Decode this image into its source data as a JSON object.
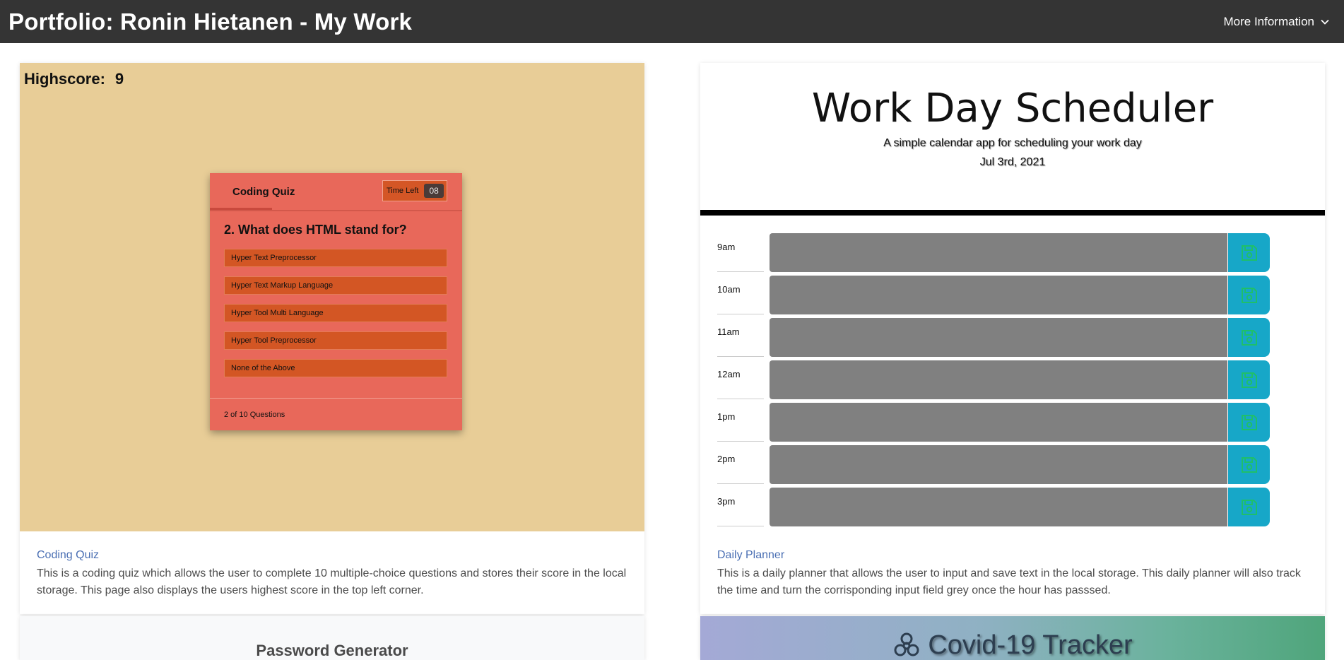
{
  "navbar": {
    "brand": "Portfolio: Ronin Hietanen - My Work",
    "more_label": "More Information"
  },
  "quiz_card": {
    "highscore_label": "Highscore:",
    "highscore_value": "9",
    "quiz_title": "Coding Quiz",
    "timer_label": "Time Left",
    "timer_value": "08",
    "question": "2. What does HTML stand for?",
    "answers": [
      "Hyper Text Preprocessor",
      "Hyper Text Markup Language",
      "Hyper Tool Multi Language",
      "Hyper Tool Preprocessor",
      "None of the Above"
    ],
    "progress": "2 of 10 Questions",
    "link": "Coding Quiz",
    "description": "This is a coding quiz which allows the user to complete 10 multiple-choice questions and stores their score in the local storage. This page also displays the users highest score in the top left corner."
  },
  "planner_card": {
    "title": "Work Day Scheduler",
    "subtitle": "A simple calendar app for scheduling your work day",
    "date": "Jul 3rd, 2021",
    "hours": [
      "9am",
      "10am",
      "11am",
      "12am",
      "1pm",
      "2pm",
      "3pm"
    ],
    "link": "Daily Planner",
    "description": "This is a daily planner that allows the user to input and save text in the local storage. This daily planner will also track the time and turn the corrisponding input field grey once the hour has passsed."
  },
  "password_card": {
    "title": "Password Generator"
  },
  "covid_card": {
    "title": "Covid-19 Tracker"
  },
  "colors": {
    "navbar_bg": "#343434",
    "quiz_bg": "#e8cd97",
    "quiz_box": "#e8685a",
    "answer_bg": "#d35624",
    "save_button": "#17a7c8",
    "past_hour": "#808080",
    "link": "#4a6fb3"
  },
  "icons": {
    "more": "chevron-down-icon",
    "save": "floppy-disk-icon",
    "covid": "biohazard-icon"
  }
}
